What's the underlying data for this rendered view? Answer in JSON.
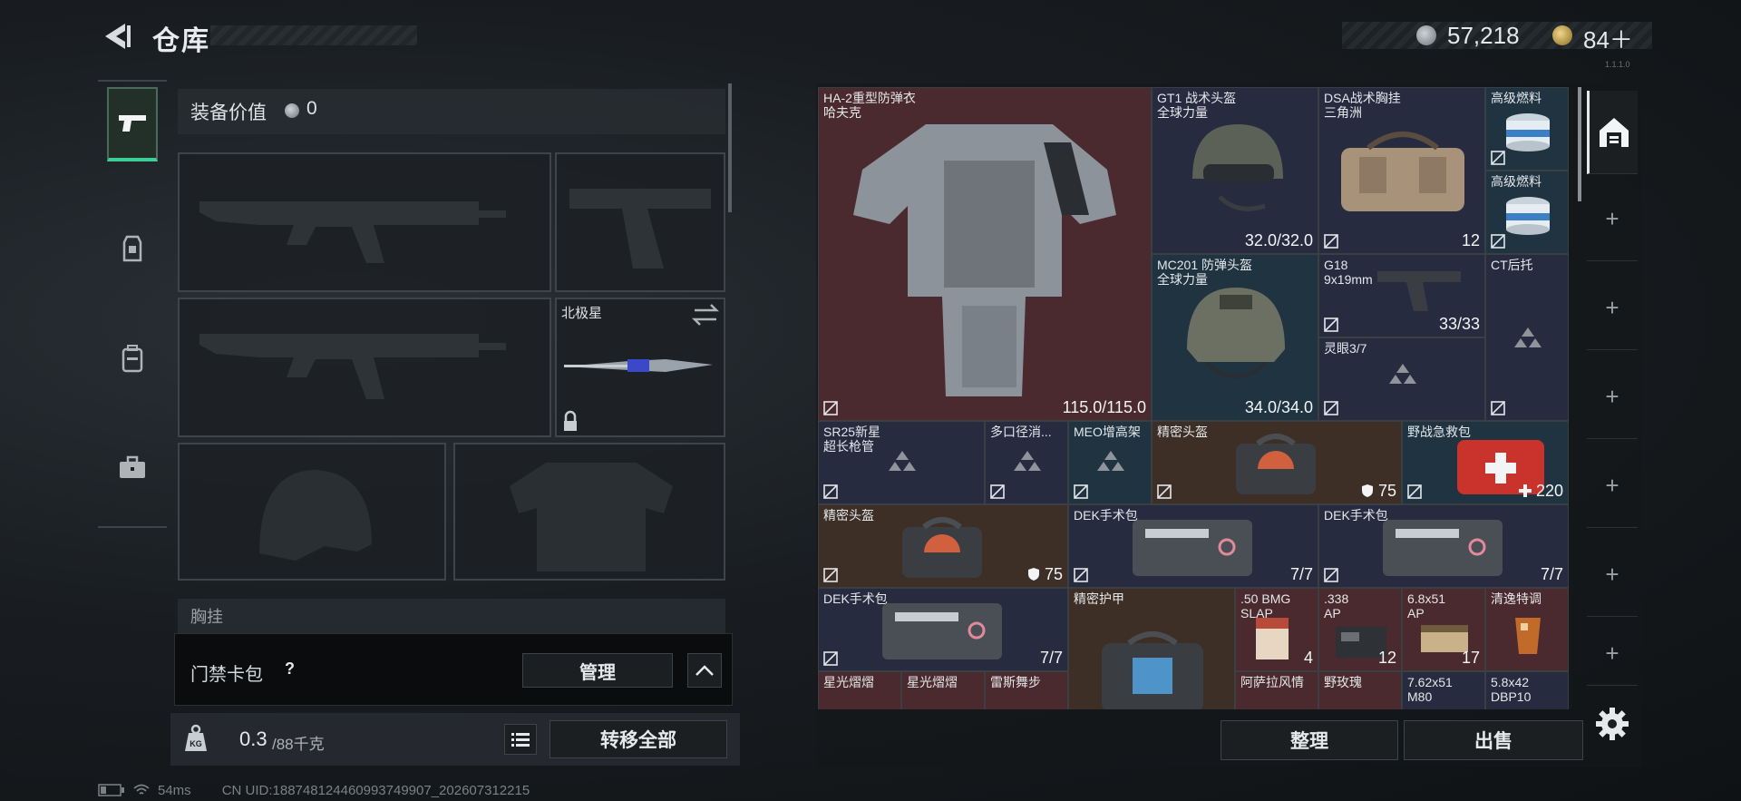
{
  "header": {
    "title": "仓库",
    "currency_silver": "57,218",
    "currency_gold": "84＋",
    "version": "1.1.1.0"
  },
  "loadout": {
    "gear_value_label": "装备价值",
    "gear_value": "0",
    "melee_name": "北极星",
    "chest_label": "胸挂"
  },
  "keycard": {
    "label": "门禁卡包",
    "help": "?",
    "manage": "管理"
  },
  "weight": {
    "current": "0.3",
    "max": "/88千克",
    "unit_icon": "KG",
    "transfer_all": "转移全部"
  },
  "status": {
    "ping": "54ms",
    "uid": "CN UID:18874812446099374990​7_202607312215"
  },
  "stash": {
    "items": [
      {
        "name": "HA-2重型防弹衣",
        "sub": "哈夫克",
        "qty": "115.0/115.0"
      },
      {
        "name": "GT1 战术头盔",
        "sub": "全球力量",
        "qty": "32.0/32.0"
      },
      {
        "name": "DSA战术胸挂",
        "sub": "三角洲",
        "qty": "12"
      },
      {
        "name": "高级燃料",
        "sub": "",
        "qty": ""
      },
      {
        "name": "高级燃料",
        "sub": "",
        "qty": ""
      },
      {
        "name": "MC201 防弹头盔",
        "sub": "全球力量",
        "qty": "34.0/34.0"
      },
      {
        "name": "G18",
        "sub": "9x19mm",
        "qty": "33/33"
      },
      {
        "name": "CT后托",
        "sub": "",
        "qty": ""
      },
      {
        "name": "灵眼3/7",
        "sub": "",
        "qty": ""
      },
      {
        "name": "SR25新星",
        "sub": "超长枪管",
        "qty": ""
      },
      {
        "name": "多口径消...",
        "sub": "",
        "qty": ""
      },
      {
        "name": "MEO增高架",
        "sub": "",
        "qty": ""
      },
      {
        "name": "精密头盔",
        "sub": "",
        "qty": "75"
      },
      {
        "name": "野战急救包",
        "sub": "",
        "qty": "220"
      },
      {
        "name": "精密头盔",
        "sub": "",
        "qty": "75"
      },
      {
        "name": "DEK手术包",
        "sub": "",
        "qty": "7/7"
      },
      {
        "name": "DEK手术包",
        "sub": "",
        "qty": "7/7"
      },
      {
        "name": "DEK手术包",
        "sub": "",
        "qty": "7/7"
      },
      {
        "name": "精密护甲",
        "sub": "",
        "qty": ""
      },
      {
        "name": ".50 BMG",
        "sub": "SLAP",
        "qty": "4"
      },
      {
        "name": ".338",
        "sub": "AP",
        "qty": "12"
      },
      {
        "name": "6.8x51",
        "sub": "AP",
        "qty": "17"
      },
      {
        "name": "清逸特调",
        "sub": "",
        "qty": ""
      },
      {
        "name": "星光熠熠",
        "sub": "",
        "qty": ""
      },
      {
        "name": "星光熠熠",
        "sub": "",
        "qty": ""
      },
      {
        "name": "雷斯舞步",
        "sub": "",
        "qty": ""
      },
      {
        "name": "阿萨拉风情",
        "sub": "",
        "qty": ""
      },
      {
        "name": "野玫瑰",
        "sub": "",
        "qty": ""
      },
      {
        "name": "7.62x51",
        "sub": "M80",
        "qty": ""
      },
      {
        "name": "5.8x42",
        "sub": "DBP10",
        "qty": ""
      }
    ],
    "sort_label": "整理",
    "sell_label": "出售"
  },
  "colors": {
    "accent": "#3ecf96",
    "red_cell": "#4a2a2e",
    "blue_cell": "#272b40",
    "teal_cell": "#1f3340",
    "brown_cell": "#3d2f26"
  }
}
